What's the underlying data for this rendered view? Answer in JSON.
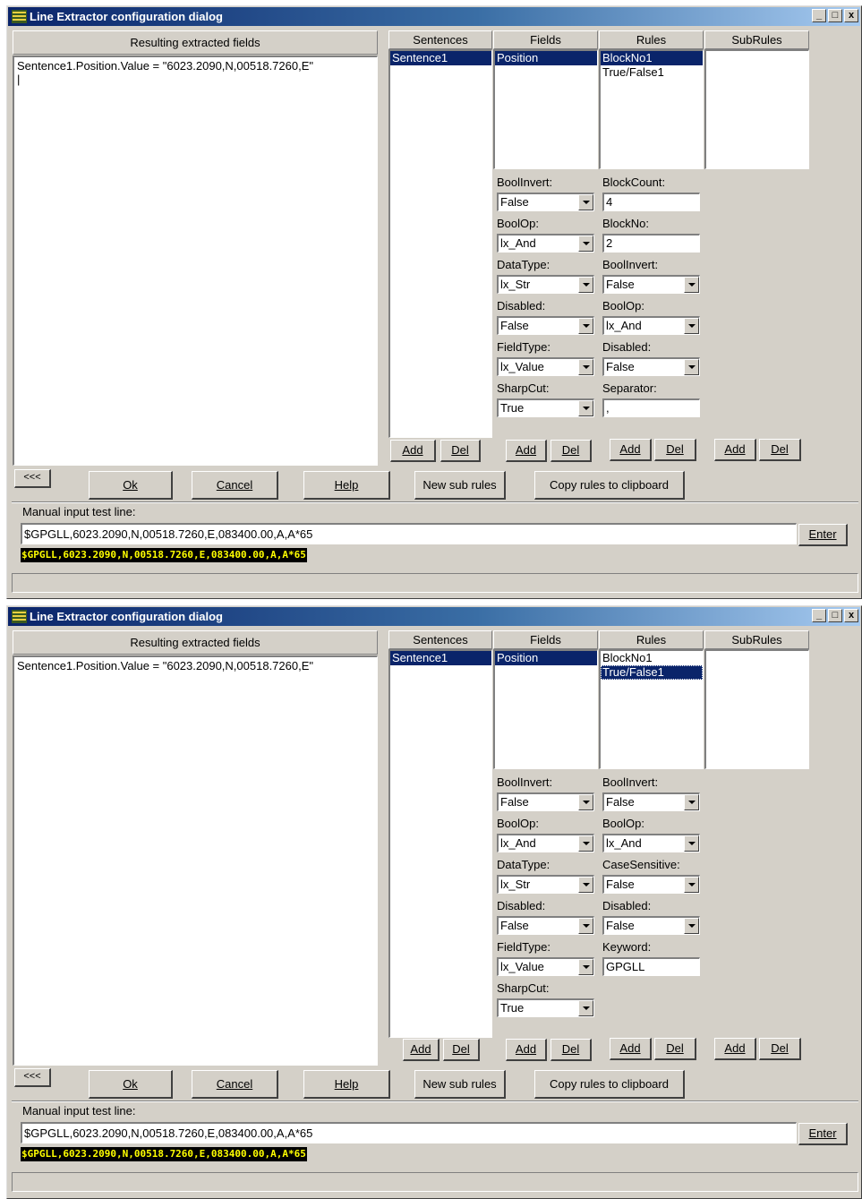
{
  "dialogs": [
    {
      "title": "Line Extractor configuration dialog",
      "results_header": "Resulting extracted fields",
      "results_text": "Sentence1.Position.Value = \"6023.2090,N,00518.7260,E\"\n|",
      "columns": {
        "sentences": "Sentences",
        "fields": "Fields",
        "rules": "Rules",
        "subrules": "SubRules"
      },
      "sentences": [
        "Sentence1"
      ],
      "fields": [
        "Position"
      ],
      "rules": [
        "BlockNo1",
        "True/False1"
      ],
      "field_props": [
        {
          "label": "BoolInvert:",
          "value": "False",
          "type": "combo"
        },
        {
          "label": "BoolOp:",
          "value": "lx_And",
          "type": "combo"
        },
        {
          "label": "DataType:",
          "value": "lx_Str",
          "type": "combo"
        },
        {
          "label": "Disabled:",
          "value": "False",
          "type": "combo"
        },
        {
          "label": "FieldType:",
          "value": "lx_Value",
          "type": "combo"
        },
        {
          "label": "SharpCut:",
          "value": "True",
          "type": "combo"
        }
      ],
      "rule_props": [
        {
          "label": "BlockCount:",
          "value": "4",
          "type": "edit"
        },
        {
          "label": "BlockNo:",
          "value": "2",
          "type": "edit"
        },
        {
          "label": "BoolInvert:",
          "value": "False",
          "type": "combo"
        },
        {
          "label": "BoolOp:",
          "value": "lx_And",
          "type": "combo"
        },
        {
          "label": "Disabled:",
          "value": "False",
          "type": "combo"
        },
        {
          "label": "Separator:",
          "value": ",",
          "type": "edit"
        }
      ],
      "test_label": "Manual input test line:",
      "test_input": "$GPGLL,6023.2090,N,00518.7260,E,083400.00,A,A*65",
      "test_output": "$GPGLL,6023.2090,N,00518.7260,E,083400.00,A,A*65"
    },
    {
      "title": "Line Extractor configuration dialog",
      "results_header": "Resulting extracted fields",
      "results_text": "Sentence1.Position.Value = \"6023.2090,N,00518.7260,E\"",
      "columns": {
        "sentences": "Sentences",
        "fields": "Fields",
        "rules": "Rules",
        "subrules": "SubRules"
      },
      "sentences": [
        "Sentence1"
      ],
      "fields": [
        "Position"
      ],
      "rules": [
        "BlockNo1",
        "True/False1"
      ],
      "field_props": [
        {
          "label": "BoolInvert:",
          "value": "False",
          "type": "combo"
        },
        {
          "label": "BoolOp:",
          "value": "lx_And",
          "type": "combo"
        },
        {
          "label": "DataType:",
          "value": "lx_Str",
          "type": "combo"
        },
        {
          "label": "Disabled:",
          "value": "False",
          "type": "combo"
        },
        {
          "label": "FieldType:",
          "value": "lx_Value",
          "type": "combo"
        },
        {
          "label": "SharpCut:",
          "value": "True",
          "type": "combo"
        }
      ],
      "rule_props": [
        {
          "label": "BoolInvert:",
          "value": "False",
          "type": "combo"
        },
        {
          "label": "BoolOp:",
          "value": "lx_And",
          "type": "combo"
        },
        {
          "label": "CaseSensitive:",
          "value": "False",
          "type": "combo"
        },
        {
          "label": "Disabled:",
          "value": "False",
          "type": "combo"
        },
        {
          "label": "Keyword:",
          "value": "GPGLL",
          "type": "edit"
        }
      ],
      "test_label": "Manual input test line:",
      "test_input": "$GPGLL,6023.2090,N,00518.7260,E,083400.00,A,A*65",
      "test_output": "$GPGLL,6023.2090,N,00518.7260,E,083400.00,A,A*65"
    }
  ],
  "labels": {
    "add": "Add",
    "del": "Del",
    "back": "<<<",
    "ok": "Ok",
    "cancel": "Cancel",
    "help": "Help",
    "new_sub_rules": "New sub rules",
    "copy_rules": "Copy rules to clipboard",
    "enter": "Enter",
    "minimize": "_",
    "maximize": "□",
    "close": "x"
  },
  "icons": {
    "title": "app-grid-icon",
    "dropdown": "chevron-down-icon"
  },
  "state": {
    "selected_rule": [
      0,
      1
    ],
    "rules_focused": [
      false,
      true
    ]
  },
  "colors": {
    "titlebar": "#0a246a",
    "face": "#d4d0c8",
    "selection": "#0a246a",
    "test_output_bg": "#000000",
    "test_output_fg": "#ffff00"
  }
}
